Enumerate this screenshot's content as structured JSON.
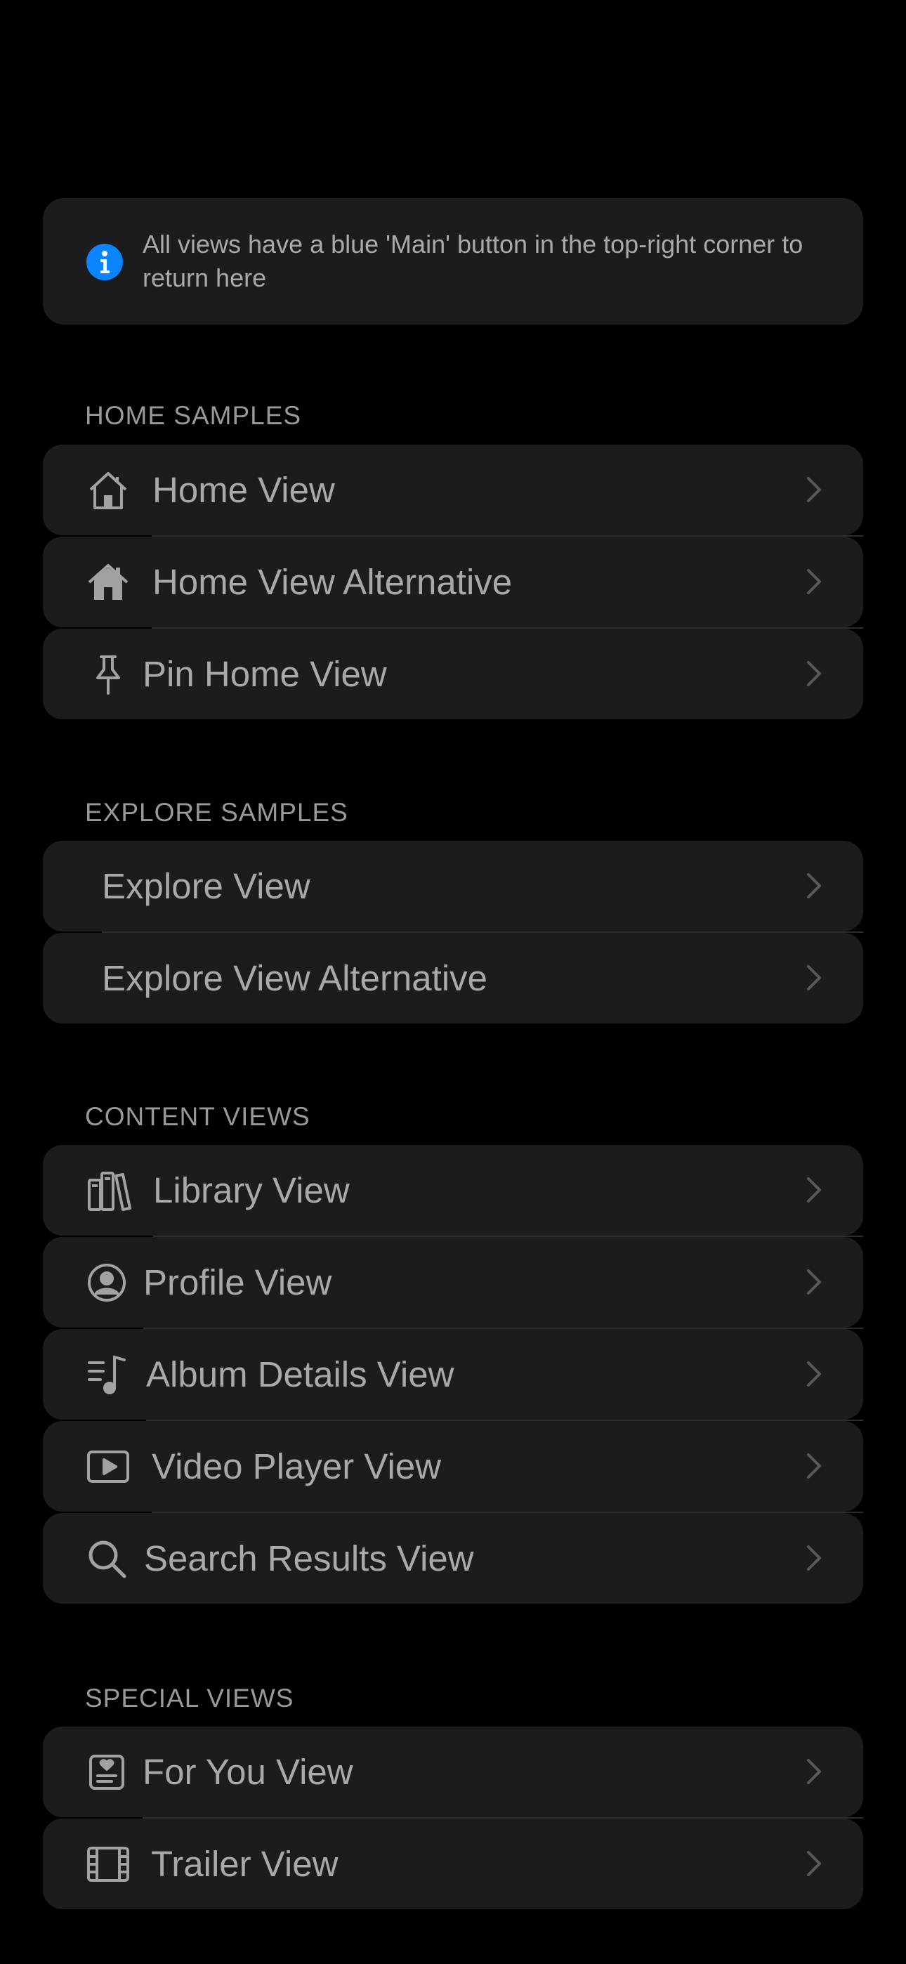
{
  "info": {
    "text": "All views have a blue 'Main' button in the top-right corner to return here",
    "icon": "info-circle-icon",
    "icon_color": "#0a84ff"
  },
  "sections": {
    "home": {
      "header": "HOME SAMPLES",
      "items": [
        {
          "label": "Home View",
          "icon": "house-outline-icon"
        },
        {
          "label": "Home View Alternative",
          "icon": "house-filled-icon"
        },
        {
          "label": "Pin Home View",
          "icon": "pin-icon"
        }
      ]
    },
    "explore": {
      "header": "EXPLORE SAMPLES",
      "items": [
        {
          "label": "Explore View"
        },
        {
          "label": "Explore View Alternative"
        }
      ]
    },
    "content": {
      "header": "CONTENT VIEWS",
      "items": [
        {
          "label": "Library View",
          "icon": "books-icon"
        },
        {
          "label": "Profile View",
          "icon": "person-circle-icon"
        },
        {
          "label": "Album Details View",
          "icon": "music-list-icon"
        },
        {
          "label": "Video Player View",
          "icon": "play-rectangle-icon"
        },
        {
          "label": "Search Results View",
          "icon": "magnifying-glass-icon"
        }
      ]
    },
    "special": {
      "header": "SPECIAL VIEWS",
      "items": [
        {
          "label": "For You View",
          "icon": "heart-text-square-icon"
        },
        {
          "label": "Trailer View",
          "icon": "film-icon"
        }
      ]
    }
  },
  "colors": {
    "background": "#000000",
    "card": "#1c1c1e",
    "text": "#a8a8ad",
    "header": "#98989d",
    "chevron": "#5a5a5e",
    "accent": "#0a84ff"
  }
}
